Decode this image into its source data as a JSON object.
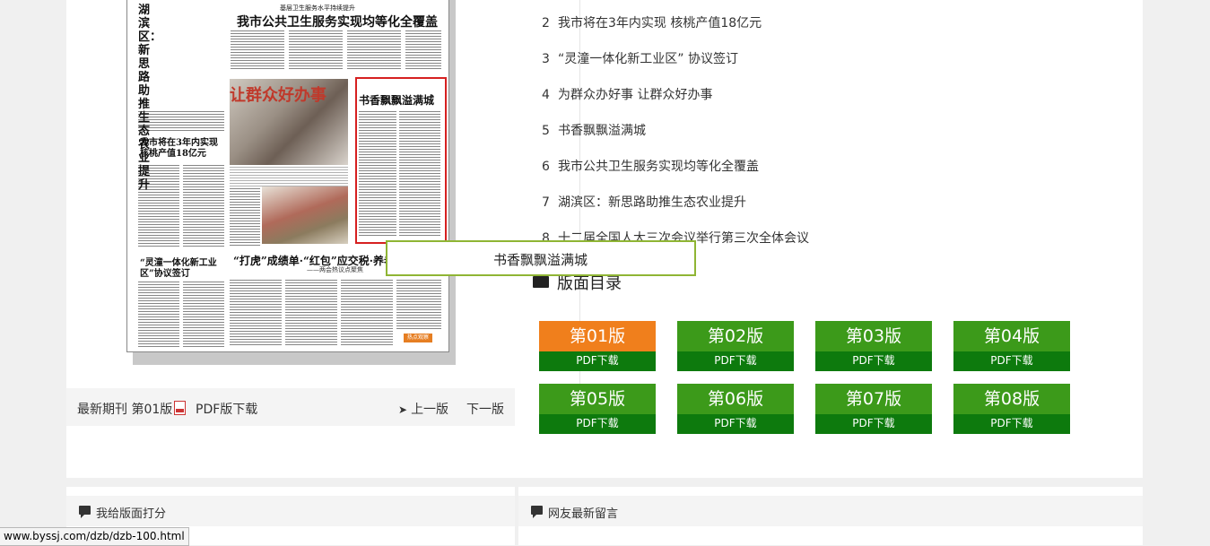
{
  "newspaper": {
    "left_vertical_headline": "湖滨区：新思路助推生态农业提升",
    "kicker": "基层卫生服务水平持续提升",
    "main_headline": "我市公共卫生服务实现均等化全覆盖",
    "photo_banner": "让群众好办事",
    "highlight_headline": "书香飘飘溢满城",
    "walnut_headline": "我市将在3年内实现核桃产值18亿元",
    "zone_headline": "“灵潼一体化新工业区”协议签订",
    "bottom_headline": "“打虎”成绩单·“红包”应交税·养老“全覆盖”",
    "bottom_subline": "——两会热议点聚焦",
    "hotspot_tag": "热点观察"
  },
  "paper_bar": {
    "latest_label": "最新期刊 第01版",
    "pdf_label": "PDF版下载",
    "prev_label": "上一版",
    "next_label": "下一版"
  },
  "articles": [
    {
      "num": "2",
      "title": "我市将在3年内实现 核桃产值18亿元"
    },
    {
      "num": "3",
      "title": "“灵潼一体化新工业区” 协议签订"
    },
    {
      "num": "4",
      "title": "为群众办好事 让群众好办事"
    },
    {
      "num": "5",
      "title": "书香飘飘溢满城"
    },
    {
      "num": "6",
      "title": "我市公共卫生服务实现均等化全覆盖"
    },
    {
      "num": "7",
      "title": "湖滨区：新思路助推生态农业提升"
    },
    {
      "num": "8",
      "title": "十二届全国人大三次会议举行第三次全体会议"
    }
  ],
  "tooltip": {
    "text": "书香飘飘溢满城"
  },
  "directory": {
    "title": "版面目录",
    "editions": [
      {
        "label": "第01版",
        "pdf": "PDF下载",
        "active": true
      },
      {
        "label": "第02版",
        "pdf": "PDF下载",
        "active": false
      },
      {
        "label": "第03版",
        "pdf": "PDF下载",
        "active": false
      },
      {
        "label": "第04版",
        "pdf": "PDF下载",
        "active": false
      },
      {
        "label": "第05版",
        "pdf": "PDF下载",
        "active": false
      },
      {
        "label": "第06版",
        "pdf": "PDF下载",
        "active": false
      },
      {
        "label": "第07版",
        "pdf": "PDF下载",
        "active": false
      },
      {
        "label": "第08版",
        "pdf": "PDF下载",
        "active": false
      }
    ]
  },
  "rating": {
    "title": "我给版面打分"
  },
  "comments": {
    "title": "网友最新留言"
  },
  "statusbar": {
    "url": "www.byssj.com/dzb/dzb-100.html"
  },
  "colors": {
    "active_edition": "#f07f1c",
    "edition": "#3c9a1a",
    "edition_pdf": "#0d7a0d",
    "tooltip_border": "#8fb534",
    "highlight_box": "#d62020"
  }
}
